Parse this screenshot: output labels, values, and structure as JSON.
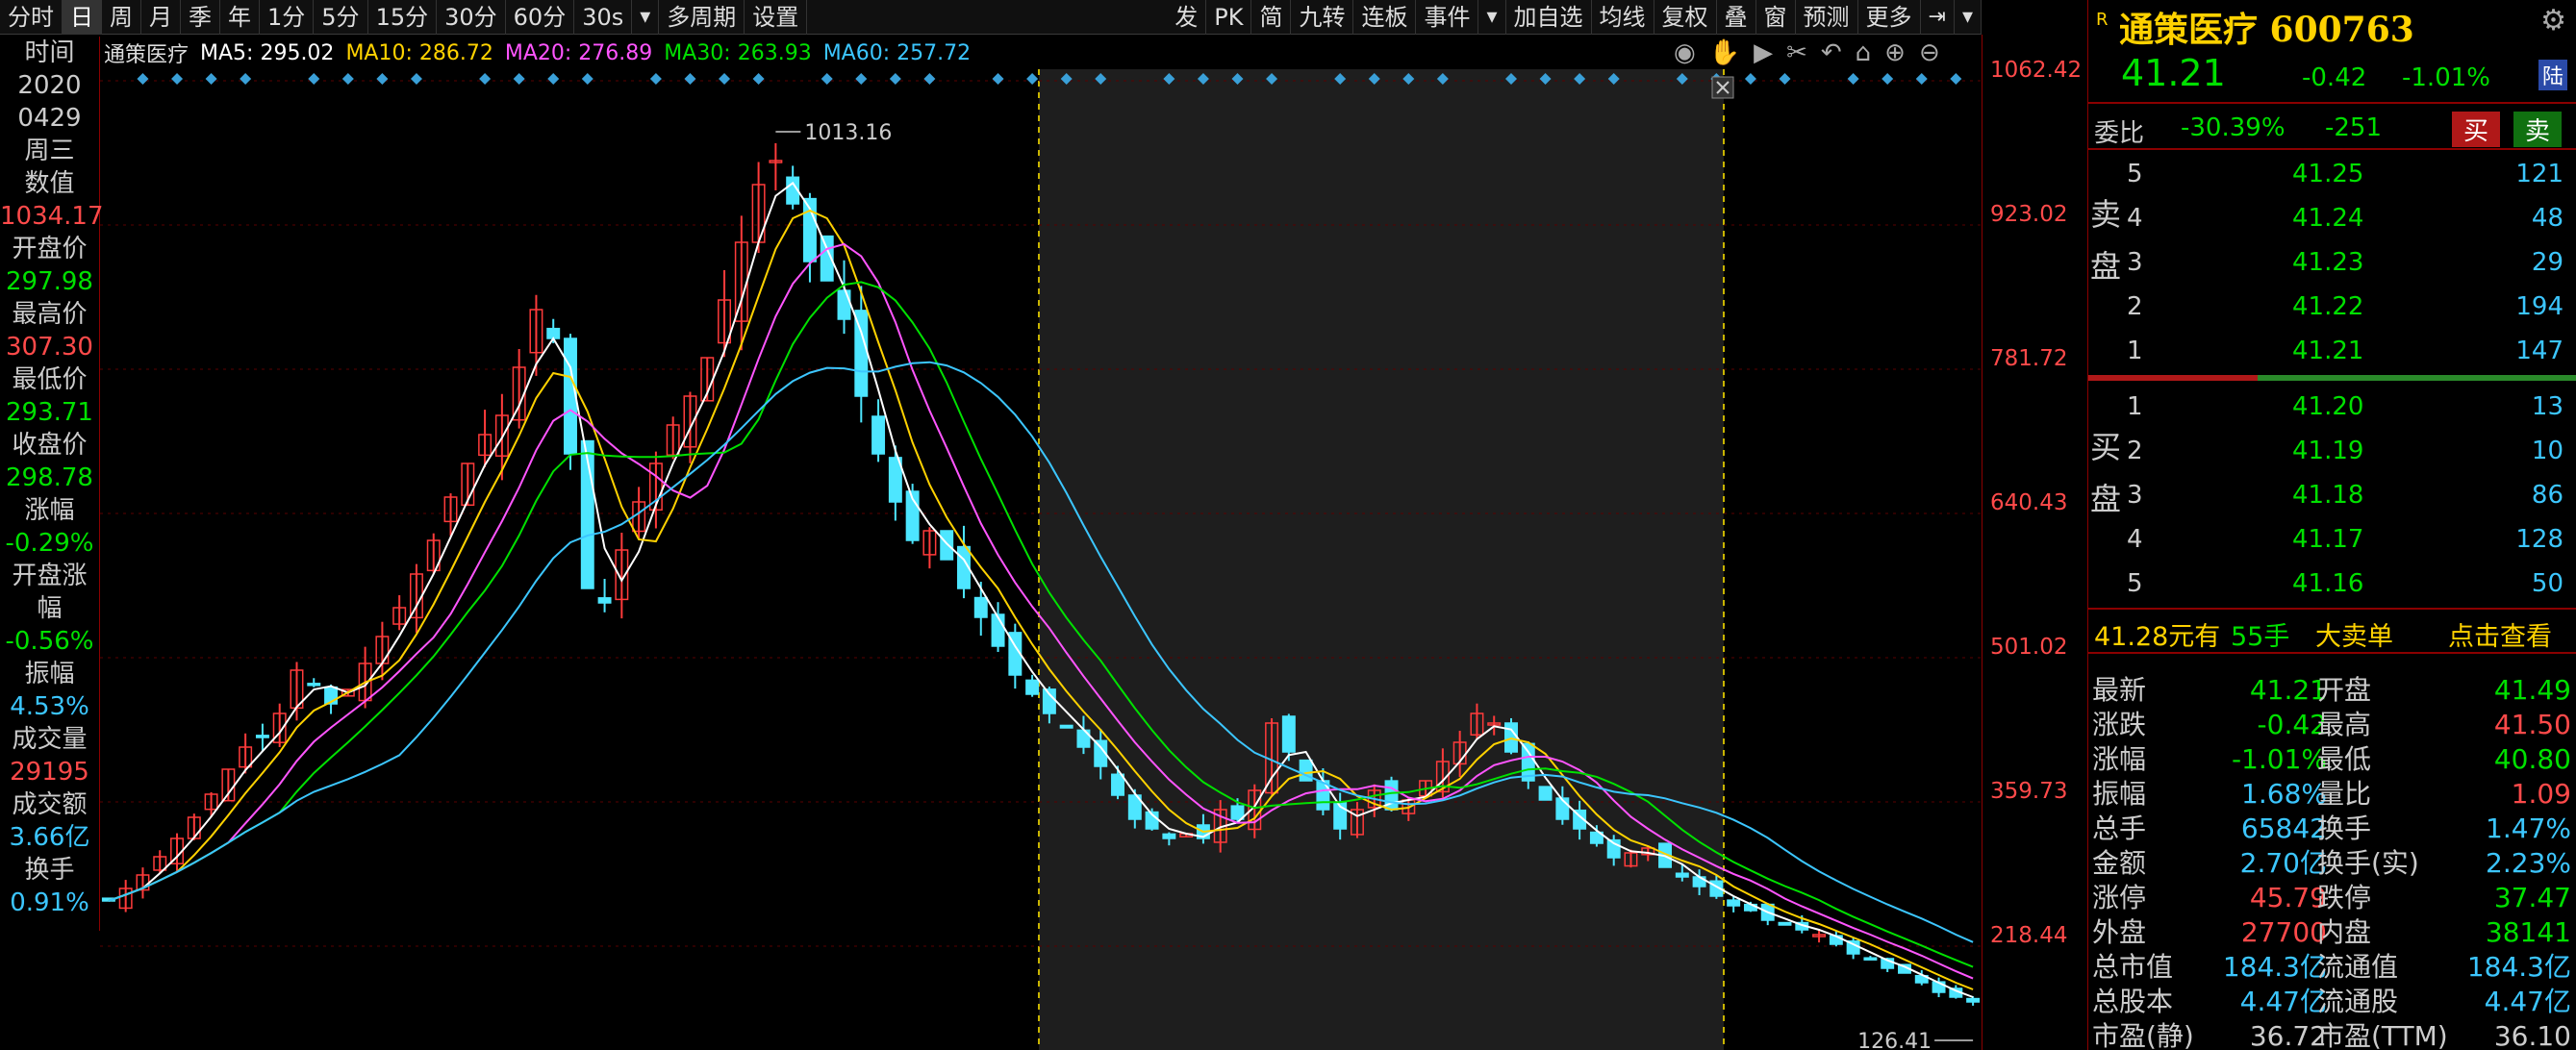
{
  "toolbar": {
    "left_tabs": [
      "分时",
      "日",
      "周",
      "月",
      "季",
      "年",
      "1分",
      "5分",
      "15分",
      "30分",
      "60分",
      "30s",
      "多周期",
      "设置"
    ],
    "active_tab": "日",
    "right_items": [
      "发",
      "PK",
      "简",
      "九转",
      "连板",
      "事件",
      "加自选",
      "均线",
      "复权",
      "叠",
      "窗",
      "预测",
      "更多"
    ]
  },
  "legend": {
    "name": "通策医疗",
    "ma5": "MA5: 295.02",
    "ma10": "MA10: 286.72",
    "ma20": "MA20: 276.89",
    "ma30": "MA30: 263.93",
    "ma60": "MA60: 257.72",
    "colors": {
      "ma5": "#ffffff",
      "ma10": "#ffd200",
      "ma20": "#ff55ff",
      "ma30": "#00e000",
      "ma60": "#3cc6ff"
    }
  },
  "info_panel": [
    {
      "label": "时间",
      "value": "2020",
      "cls": "lbl"
    },
    {
      "label": "",
      "value": "0429",
      "cls": "lbl"
    },
    {
      "label": "",
      "value": "周三",
      "cls": "lbl"
    },
    {
      "label": "数值",
      "value": "1034.17",
      "cls": "red"
    },
    {
      "label": "开盘价",
      "value": "297.98",
      "cls": "green"
    },
    {
      "label": "最高价",
      "value": "307.30",
      "cls": "red"
    },
    {
      "label": "最低价",
      "value": "293.71",
      "cls": "green"
    },
    {
      "label": "收盘价",
      "value": "298.78",
      "cls": "green"
    },
    {
      "label": "涨幅",
      "value": "-0.29%",
      "cls": "green"
    },
    {
      "label": "开盘涨幅",
      "value": "-0.56%",
      "cls": "green"
    },
    {
      "label": "振幅",
      "value": "4.53%",
      "cls": "cyan"
    },
    {
      "label": "成交量",
      "value": "29195",
      "cls": "red"
    },
    {
      "label": "成交额",
      "value": "3.66亿",
      "cls": "cyan"
    },
    {
      "label": "换手",
      "value": "0.91%",
      "cls": "cyan"
    }
  ],
  "y_axis": [
    "1062.42",
    "923.02",
    "781.72",
    "640.43",
    "501.02",
    "359.73",
    "218.44"
  ],
  "chart_data": {
    "type": "line",
    "max_label": "1013.16",
    "min_label": "126.41",
    "ylim": [
      80,
      1100
    ],
    "close": [
      235,
      248,
      262,
      281,
      300,
      322,
      346,
      372,
      395,
      405,
      430,
      475,
      460,
      440,
      455,
      482,
      510,
      540,
      575,
      610,
      655,
      690,
      720,
      740,
      790,
      850,
      820,
      700,
      560,
      545,
      600,
      650,
      690,
      730,
      760,
      800,
      860,
      920,
      980,
      1005,
      960,
      900,
      880,
      840,
      760,
      700,
      650,
      610,
      620,
      590,
      560,
      530,
      500,
      470,
      450,
      430,
      415,
      395,
      375,
      345,
      320,
      310,
      300,
      305,
      300,
      330,
      320,
      350,
      420,
      390,
      360,
      330,
      310,
      330,
      350,
      330,
      340,
      360,
      380,
      400,
      430,
      420,
      390,
      360,
      340,
      320,
      310,
      295,
      280,
      285,
      290,
      270,
      260,
      250,
      240,
      230,
      225,
      215,
      210,
      205,
      200,
      190,
      180,
      175,
      165,
      160,
      150,
      140,
      135,
      130
    ]
  },
  "quote": {
    "r": "R",
    "title": "通策医疗 600763",
    "price": "41.21",
    "change": "-0.42",
    "pct": "-1.01%",
    "board": "陆",
    "wb_label": "委比",
    "wb_pct": "-30.39%",
    "wb_val": "-251",
    "buy_btn": "买",
    "sell_btn": "卖",
    "sell_side": "卖盘",
    "buy_side": "买盘",
    "asks": [
      {
        "lvl": "5",
        "price": "41.25",
        "vol": "121"
      },
      {
        "lvl": "4",
        "price": "41.24",
        "vol": "48"
      },
      {
        "lvl": "3",
        "price": "41.23",
        "vol": "29"
      },
      {
        "lvl": "2",
        "price": "41.22",
        "vol": "194"
      },
      {
        "lvl": "1",
        "price": "41.21",
        "vol": "147"
      }
    ],
    "bids": [
      {
        "lvl": "1",
        "price": "41.20",
        "vol": "13"
      },
      {
        "lvl": "2",
        "price": "41.19",
        "vol": "10"
      },
      {
        "lvl": "3",
        "price": "41.18",
        "vol": "86"
      },
      {
        "lvl": "4",
        "price": "41.17",
        "vol": "128"
      },
      {
        "lvl": "5",
        "price": "41.16",
        "vol": "50"
      }
    ],
    "big_order": {
      "price": "41.28元有",
      "qty": "55手",
      "type": "大卖单",
      "link": "点击查看"
    },
    "stats": [
      [
        "最新",
        "41.21",
        "开盘",
        "41.49"
      ],
      [
        "涨跌",
        "-0.42",
        "最高",
        "41.50"
      ],
      [
        "涨幅",
        "-1.01%",
        "最低",
        "40.80"
      ],
      [
        "振幅",
        "1.68%",
        "量比",
        "1.09"
      ],
      [
        "总手",
        "65842",
        "换手",
        "1.47%"
      ],
      [
        "金额",
        "2.70亿",
        "换手(实)",
        "2.23%"
      ],
      [
        "涨停",
        "45.79",
        "跌停",
        "37.47"
      ],
      [
        "外盘",
        "27700",
        "内盘",
        "38141"
      ],
      [
        "总市值",
        "184.3亿",
        "流通值",
        "184.3亿"
      ],
      [
        "总股本",
        "4.47亿",
        "流通股",
        "4.47亿"
      ],
      [
        "市盈(静)",
        "36.72",
        "市盈(TTM)",
        "36.10"
      ]
    ],
    "stat_colors": [
      [
        "#00e000",
        "#00e000"
      ],
      [
        "#00e000",
        "#ff4a4a"
      ],
      [
        "#00e000",
        "#00e000"
      ],
      [
        "#3cc6ff",
        "#ff4a4a"
      ],
      [
        "#3cc6ff",
        "#3cc6ff"
      ],
      [
        "#3cc6ff",
        "#3cc6ff"
      ],
      [
        "#ff4a4a",
        "#00e000"
      ],
      [
        "#ff4a4a",
        "#00e000"
      ],
      [
        "#3cc6ff",
        "#3cc6ff"
      ],
      [
        "#3cc6ff",
        "#3cc6ff"
      ],
      [
        "#ccc",
        "#ccc"
      ]
    ]
  }
}
